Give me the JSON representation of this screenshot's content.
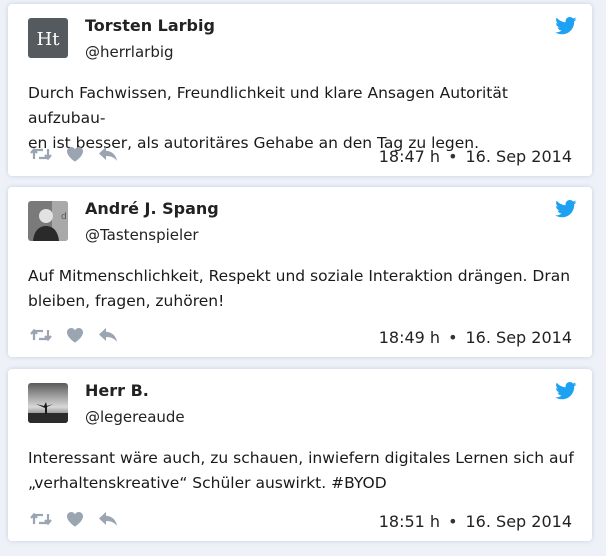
{
  "tweets": [
    {
      "name": "Torsten Larbig",
      "handle": "@herrlarbig",
      "avatar_text": "Ht",
      "text_line1": "Durch Fachwissen, Freundlichkeit und klare Ansagen Autorität aufzubau-",
      "text_line2": "en ist besser, als autoritäres Gehabe an den Tag zu legen.",
      "time": "18:47 h",
      "separator": "•",
      "date": "16. Sep 2014"
    },
    {
      "name": "André J. Spang",
      "handle": "@Tastenspieler",
      "text_line1": "Auf Mitmenschlichkeit, Respekt und soziale Interaktion drängen. Dran",
      "text_line2": "bleiben, fragen, zuhören!",
      "time": "18:49 h",
      "separator": "•",
      "date": "16. Sep 2014"
    },
    {
      "name": "Herr B.",
      "handle": "@legereaude",
      "text_line1": "Interessant wäre auch, zu schauen, inwiefern digitales Lernen sich auf",
      "text_line2": "„verhaltenskreative“ Schüler auswirkt. #BYOD",
      "time": "18:51 h",
      "separator": "•",
      "date": "16. Sep 2014"
    }
  ],
  "colors": {
    "twitter_blue": "#1da1f2",
    "icon_gray": "#9aa5b1",
    "background": "#eef2f8"
  },
  "icons": [
    "retweet-icon",
    "like-heart-icon",
    "reply-icon",
    "twitter-bird-icon"
  ]
}
